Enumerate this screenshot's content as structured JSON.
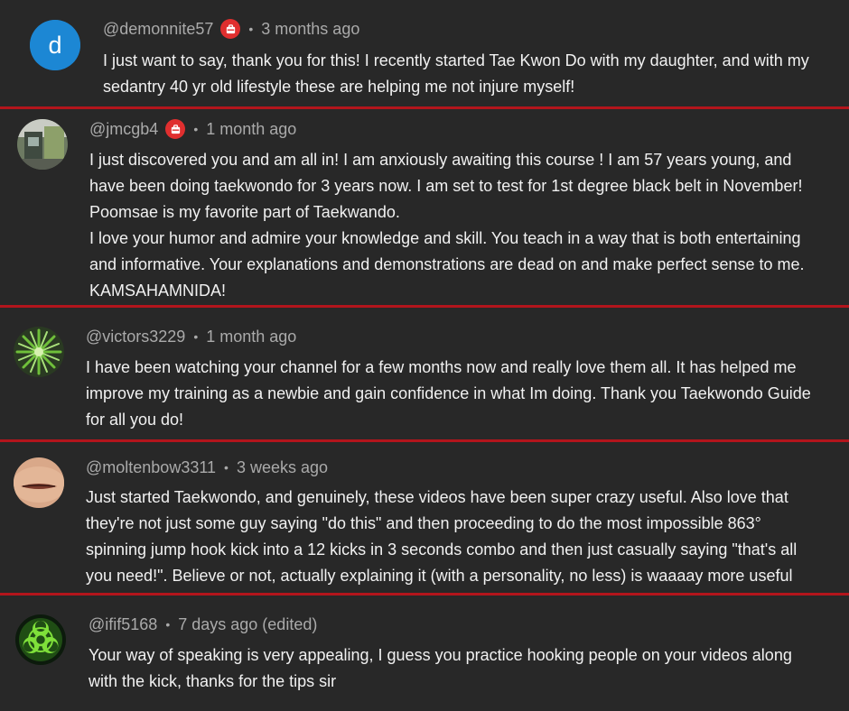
{
  "comments": [
    {
      "author": "@demonnite57",
      "has_badge": true,
      "time": "3 months ago",
      "avatar_letter": "d",
      "lines": [
        "I just want to say, thank you for this! I recently started Tae Kwon Do with my daughter, and with my",
        "sedantry 40 yr old lifestyle these are helping me not injure myself!"
      ]
    },
    {
      "author": "@jmcgb4",
      "has_badge": true,
      "time": "1 month ago",
      "lines": [
        "I just discovered you and am all in! I am anxiously awaiting this course ! I am 57 years young, and",
        "have been doing taekwondo for 3 years now. I am set to test for 1st degree black belt in November!",
        "Poomsae is my favorite part of Taekwando.",
        "I love your humor and admire your knowledge and skill. You teach in a way that is both entertaining",
        "and informative. Your explanations and demonstrations are dead on and make perfect sense to me.",
        "KAMSAHAMNIDA!"
      ]
    },
    {
      "author": "@victors3229",
      "has_badge": false,
      "time": "1 month ago",
      "lines": [
        "I have been watching your channel for a few months now and really love them all. It has helped me",
        "improve my training as a newbie and gain confidence in what Im doing. Thank you Taekwondo Guide",
        "for all you do!"
      ]
    },
    {
      "author": "@moltenbow3311",
      "has_badge": false,
      "time": "3 weeks ago",
      "lines": [
        "Just started Taekwondo, and genuinely, these videos have been super crazy useful. Also love that",
        "they're not just some guy saying \"do this\" and then proceeding to do the most impossible 863°",
        "spinning jump hook kick into a 12 kicks in 3 seconds combo and then just casually saying \"that's all",
        "you need!\". Believe or not, actually explaining it (with a personality, no less) is waaaay more useful"
      ]
    },
    {
      "author": "@ifif5168",
      "has_badge": false,
      "time": "7 days ago (edited)",
      "lines": [
        "Your way of speaking is very appealing, I guess you practice hooking people on your videos along",
        "with the kick, thanks for the tips sir"
      ]
    }
  ],
  "separator_dot": "•",
  "colors": {
    "background": "#282828",
    "separator": "#b3151c",
    "badge": "#e02f2f",
    "meta_text": "#aaaaaa",
    "body_text": "#f1f1f1",
    "letter_avatar": "#1c87d4"
  }
}
